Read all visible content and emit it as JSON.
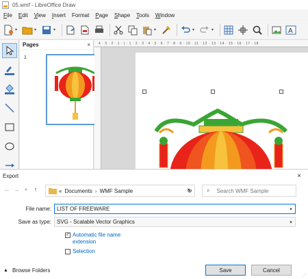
{
  "window": {
    "title": "05.wmf - LibreOffice Draw"
  },
  "menu": [
    {
      "key": "F",
      "rest": "ile"
    },
    {
      "key": "E",
      "rest": "dit"
    },
    {
      "key": "V",
      "rest": "iew"
    },
    {
      "key": "I",
      "rest": "nsert"
    },
    {
      "key": "",
      "rest": "Format"
    },
    {
      "key": "P",
      "rest": "age"
    },
    {
      "key": "S",
      "rest": "hape"
    },
    {
      "key": "T",
      "rest": "ools"
    },
    {
      "key": "W",
      "rest": "indow"
    }
  ],
  "pages_panel": {
    "title": "Pages",
    "close": "×",
    "page_number": "1"
  },
  "ruler": {
    "marks": "4 · 3 · 2 · 1 · | · 1 · 2 · 3 · 4 · 5 · 6 · 7 · 8 · 9 · 10 · 11 · 12 · 13 · 14 · 15 · 16 · 17 · 18"
  },
  "dialog": {
    "title": "Export",
    "close": "×",
    "path": {
      "prefix": "«",
      "folder1": "Documents",
      "separator": "›",
      "folder2": "WMF Sample"
    },
    "search_placeholder": "Search WMF Sample",
    "file_name_label": "File name:",
    "file_name_value": "LIST OF FREEWARE",
    "save_type_label": "Save as type:",
    "save_type_value": "SVG - Scalable Vector Graphics",
    "auto_ext_label_line1": "Automatic file name",
    "auto_ext_label_line2": "extension",
    "auto_ext_checked": "✓",
    "selection_label": "Selection",
    "browse_folders": "Browse Folders",
    "save_button": "Save",
    "cancel_button": "Cancel"
  },
  "colors": {
    "accent": "#0078d7",
    "lantern_red": "#e8231a",
    "lantern_orange": "#f39a1e",
    "lantern_green": "#3aa534"
  }
}
